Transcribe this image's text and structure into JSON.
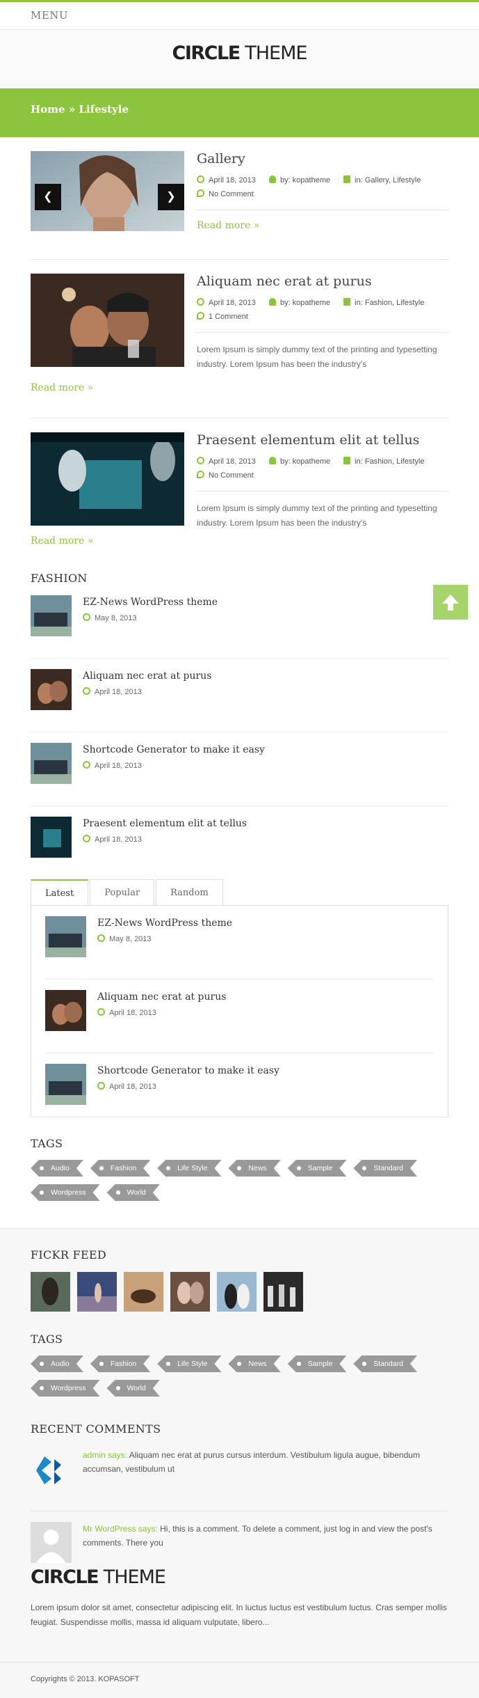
{
  "menu": {
    "label": "MENU"
  },
  "logo": {
    "bold": "CIRCLE",
    "light": " THEME"
  },
  "breadcrumb": {
    "text": "Home » Lifestyle"
  },
  "posts": [
    {
      "title": "Gallery",
      "date": "April 18, 2013",
      "author": "by: kopatheme",
      "cats": "in: Gallery, Lifestyle",
      "comments": "No Comment",
      "excerpt": "",
      "read": "Read more »"
    },
    {
      "title": "Aliquam nec erat at purus",
      "date": "April 18, 2013",
      "author": "by: kopatheme",
      "cats": "in: Fashion, Lifestyle",
      "comments": "1 Comment",
      "excerpt": "Lorem Ipsum is simply dummy text of the printing and typesetting industry. Lorem Ipsum has been the industry's",
      "read": "Read more »"
    },
    {
      "title": "Praesent elementum elit at tellus",
      "date": "April 18, 2013",
      "author": "by: kopatheme",
      "cats": "in: Fashion, Lifestyle",
      "comments": "No Comment",
      "excerpt": "Lorem Ipsum is simply dummy text of the printing and typesetting industry. Lorem Ipsum has been the industry's",
      "read": "Read more »"
    }
  ],
  "fashion": {
    "title": "FASHION",
    "items": [
      {
        "title": "EZ-News WordPress theme",
        "date": "May 8, 2013"
      },
      {
        "title": "Aliquam nec erat at purus",
        "date": "April 18, 2013"
      },
      {
        "title": "Shortcode Generator to make it easy",
        "date": "April 18, 2013"
      },
      {
        "title": "Praesent elementum elit at tellus",
        "date": "April 18, 2013"
      }
    ]
  },
  "tabs": {
    "labels": [
      "Latest",
      "Popular",
      "Random"
    ],
    "items": [
      {
        "title": "EZ-News WordPress theme",
        "date": "May 8, 2013"
      },
      {
        "title": "Aliquam nec erat at purus",
        "date": "April 18, 2013"
      },
      {
        "title": "Shortcode Generator to make it easy",
        "date": "April 18, 2013"
      }
    ]
  },
  "tags": {
    "title": "TAGS",
    "items": [
      "Audio",
      "Fashion",
      "Life Style",
      "News",
      "Sample",
      "Standard",
      "Wordpress",
      "World"
    ]
  },
  "flickr": {
    "title": "FICKR FEED"
  },
  "tags2": {
    "title": "TAGS"
  },
  "recent": {
    "title": "RECENT COMMENTS",
    "items": [
      {
        "author": "admin says:",
        "text": " Aliquam nec erat at purus cursus interdum. Vestibulum ligula augue, bibendum accumsan, vestibulum ut"
      },
      {
        "author": "Mr WordPress says:",
        "text": " Hi, this is a comment. To delete a comment, just log in and view the post's comments. There you"
      }
    ]
  },
  "about": {
    "text": "Lorem ipsum dolor sit amet, consectetur adipiscing elit. In luctus luctus est vestibulum luctus. Cras semper mollis feugiat. Suspendisse mollis, massa id aliquam vulputate, libero..."
  },
  "copyright": "Copyrights © 2013. KOPASOFT",
  "colors": {
    "accent": "#8cc43e",
    "tag": "#999999"
  }
}
